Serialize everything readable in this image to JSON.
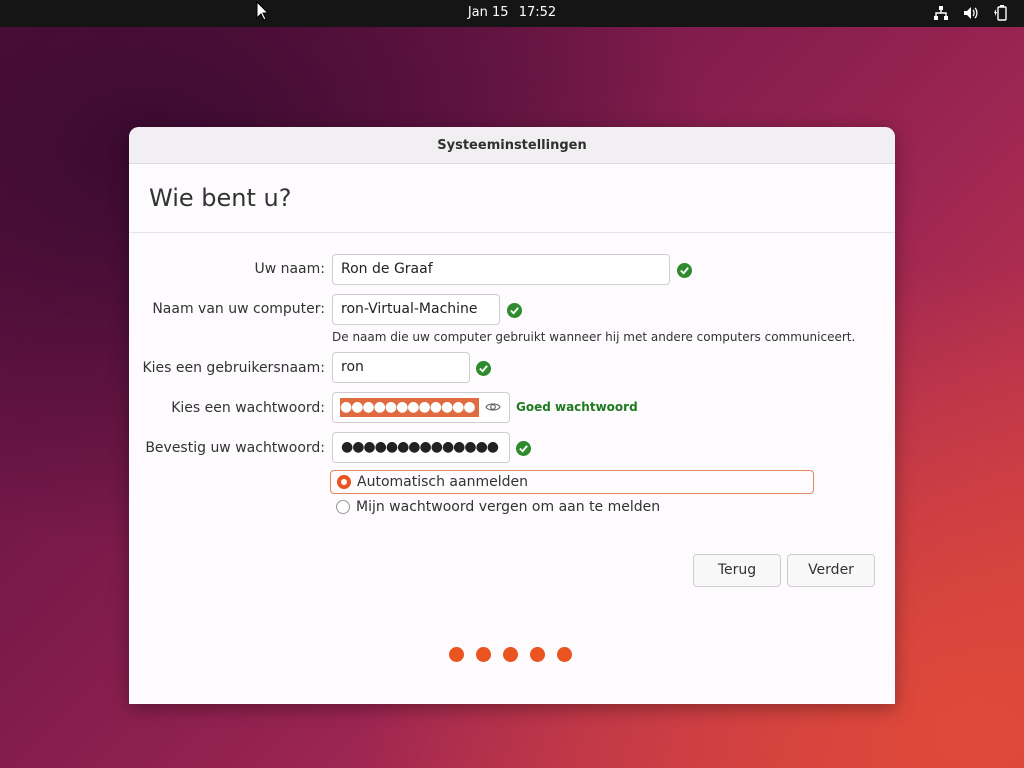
{
  "topbar": {
    "date": "Jan 15",
    "time": "17:52",
    "icons": [
      "network-icon",
      "volume-icon",
      "battery-icon"
    ]
  },
  "dialog": {
    "title": "Systeeminstellingen",
    "heading": "Wie bent u?",
    "fields": {
      "name": {
        "label": "Uw naam:",
        "value": "Ron de Graaf",
        "valid": true
      },
      "computer": {
        "label": "Naam van uw computer:",
        "value": "ron-Virtual-Machine",
        "valid": true,
        "hint": "De naam die uw computer gebruikt wanneer hij met andere computers communiceert."
      },
      "username": {
        "label": "Kies een gebruikersnaam:",
        "value": "ron",
        "valid": true
      },
      "password": {
        "label": "Kies een wachtwoord:",
        "masked": "●●●●●●●●●●●●",
        "strength": "Goed wachtwoord"
      },
      "confirm": {
        "label": "Bevestig uw wachtwoord:",
        "masked": "●●●●●●●●●●●●●●",
        "valid": true
      }
    },
    "login_options": [
      {
        "label": "Automatisch aanmelden",
        "selected": true
      },
      {
        "label": "Mijn wachtwoord vergen om aan te melden",
        "selected": false
      }
    ],
    "buttons": {
      "back": "Terug",
      "next": "Verder"
    },
    "progress": {
      "steps": 5
    }
  },
  "colors": {
    "accent": "#e95420",
    "valid": "#2e8b2e",
    "strength": "#1f7a1f"
  }
}
